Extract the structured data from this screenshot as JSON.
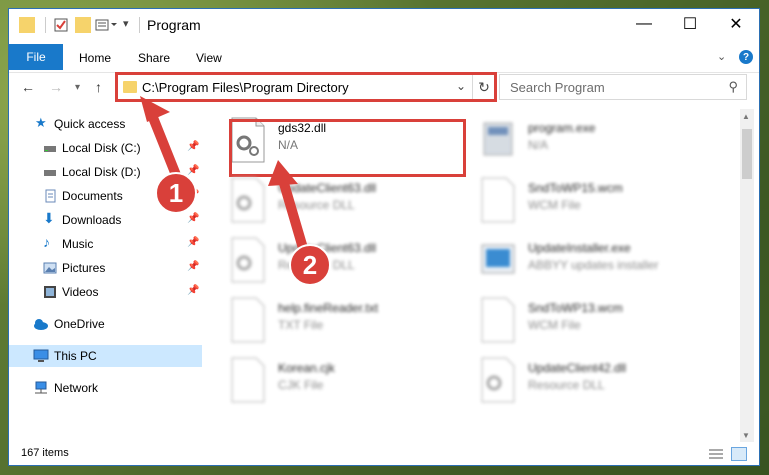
{
  "window": {
    "title": "Program"
  },
  "ribbon": {
    "file": "File",
    "tabs": [
      "Home",
      "Share",
      "View"
    ]
  },
  "address": {
    "path": "C:\\Program Files\\Program Directory"
  },
  "search": {
    "placeholder": "Search Program"
  },
  "sidebar": {
    "items": [
      {
        "label": "Quick access",
        "icon": "star-icon"
      },
      {
        "label": "Local Disk (C:)",
        "icon": "drive-icon"
      },
      {
        "label": "Local Disk (D:)",
        "icon": "drive-icon"
      },
      {
        "label": "Documents",
        "icon": "documents-icon"
      },
      {
        "label": "Downloads",
        "icon": "download-icon"
      },
      {
        "label": "Music",
        "icon": "music-icon"
      },
      {
        "label": "Pictures",
        "icon": "pictures-icon"
      },
      {
        "label": "Videos",
        "icon": "videos-icon"
      },
      {
        "label": "OneDrive",
        "icon": "cloud-icon"
      },
      {
        "label": "This PC",
        "icon": "computer-icon"
      },
      {
        "label": "Network",
        "icon": "network-icon"
      }
    ]
  },
  "files": [
    {
      "name": "gds32.dll",
      "type": "N/A"
    },
    {
      "name": "program.exe",
      "type": "N/A"
    },
    {
      "name": "UpdateClient63.dll",
      "type": "Resource DLL"
    },
    {
      "name": "SndToWP15.wcm",
      "type": "WCM File"
    },
    {
      "name": "UpdateClient63.dll",
      "type": "Resource DLL"
    },
    {
      "name": "UpdateInstaller.exe",
      "type": "ABBYY updates installer"
    },
    {
      "name": "help.fineReader.txt",
      "type": "TXT File"
    },
    {
      "name": "SndToWP13.wcm",
      "type": "WCM File"
    },
    {
      "name": "Korean.cjk",
      "type": "CJK File"
    },
    {
      "name": "UpdateClient42.dll",
      "type": "Resource DLL"
    }
  ],
  "status": {
    "count": "167 items"
  },
  "annotations": {
    "step1": "1",
    "step2": "2"
  },
  "colors": {
    "accent": "#1979ca",
    "highlight": "#d9403a",
    "selected": "#cce8ff"
  }
}
